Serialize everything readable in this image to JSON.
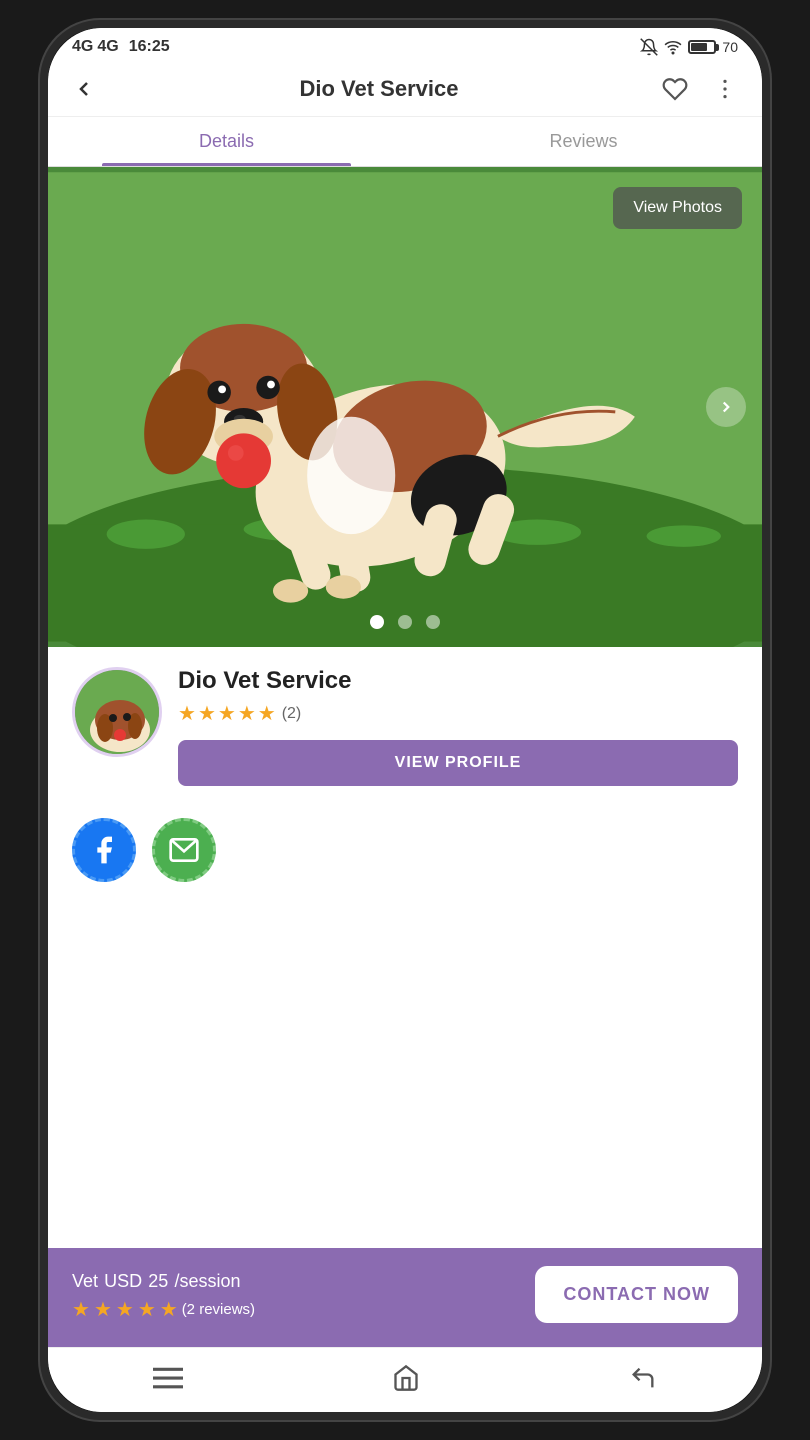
{
  "status": {
    "network1": "4G",
    "network2": "4G",
    "time": "16:25",
    "battery": 70
  },
  "header": {
    "title": "Dio Vet Service",
    "back_label": "‹",
    "favorite_icon": "heart",
    "more_icon": "more-vertical"
  },
  "tabs": [
    {
      "id": "details",
      "label": "Details",
      "active": true
    },
    {
      "id": "reviews",
      "label": "Reviews",
      "active": false
    }
  ],
  "slider": {
    "view_photos_label": "View Photos",
    "dots": [
      {
        "active": true
      },
      {
        "active": false
      },
      {
        "active": false
      }
    ],
    "next_icon": "›"
  },
  "service": {
    "name": "Dio Vet Service",
    "rating": 4.5,
    "review_count": "(2)",
    "view_profile_label": "VIEW PROFILE"
  },
  "social": {
    "icons": [
      {
        "type": "facebook",
        "label": "Facebook"
      },
      {
        "type": "email",
        "label": "Email"
      }
    ]
  },
  "bottom_bar": {
    "category": "Vet",
    "currency": "USD",
    "price": "25",
    "per": "/session",
    "stars_count": 5,
    "review_count": "(2 reviews)",
    "contact_label": "CONTACT NOW"
  },
  "nav": {
    "menu_icon": "menu",
    "home_icon": "home",
    "back_icon": "back-arrow"
  }
}
